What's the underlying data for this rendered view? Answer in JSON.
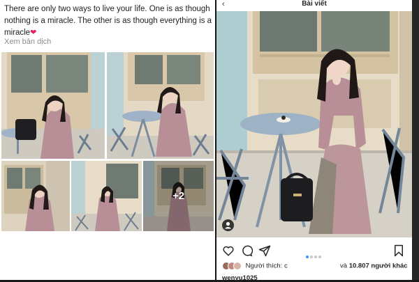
{
  "facebook_post": {
    "text": "There are only two ways to live your life. One is as though nothing is a miracle. The other is as though everything is a miracle",
    "heart": "❤",
    "see_translation": "Xem bản dịch",
    "photos": [
      {
        "name": "post-photo-1",
        "alt": "woman in pink dress at cafe table"
      },
      {
        "name": "post-photo-2",
        "alt": "woman seated at blue round table"
      },
      {
        "name": "post-photo-3",
        "alt": "woman standing by window"
      },
      {
        "name": "post-photo-4",
        "alt": "woman by cafe chairs"
      },
      {
        "name": "post-photo-5",
        "alt": "woman standing full body"
      }
    ],
    "more_count": "+2"
  },
  "instagram_post": {
    "back_glyph": "‹",
    "header_title": "Bài viết",
    "actions": [
      "like-icon",
      "comment-icon",
      "share-icon",
      "save-icon"
    ],
    "carousel_active": 0,
    "carousel_total": 4,
    "likes": {
      "prefix": "Người thích:",
      "middle": "c",
      "and": "và",
      "count": "10.807",
      "suffix": "người khác"
    },
    "caption_username": "wenyu1025"
  },
  "colors": {
    "dress": "#b88f97",
    "table": "#9eb2c6",
    "wall": "#e8dcc6",
    "instagram_blue": "#3897f0"
  }
}
